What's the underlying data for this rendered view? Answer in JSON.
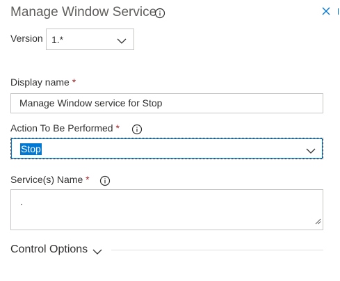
{
  "panel": {
    "title": "Manage Window Service"
  },
  "version": {
    "label": "Version",
    "value": "1.*"
  },
  "display_name": {
    "label": "Display name",
    "required_mark": "*",
    "value": "Manage Window service for Stop"
  },
  "action": {
    "label": "Action To Be Performed",
    "required_mark": "*",
    "value": "Stop"
  },
  "service_name": {
    "label": "Service(s) Name",
    "required_mark": "*",
    "value": "."
  },
  "control_options": {
    "label": "Control Options"
  },
  "colors": {
    "accent": "#0078d4",
    "required": "#a4262c",
    "border": "#c8c6c4",
    "text": "#323130"
  },
  "icons": [
    "info-icon",
    "close-icon",
    "chevron-down-icon",
    "resize-grip-icon"
  ]
}
